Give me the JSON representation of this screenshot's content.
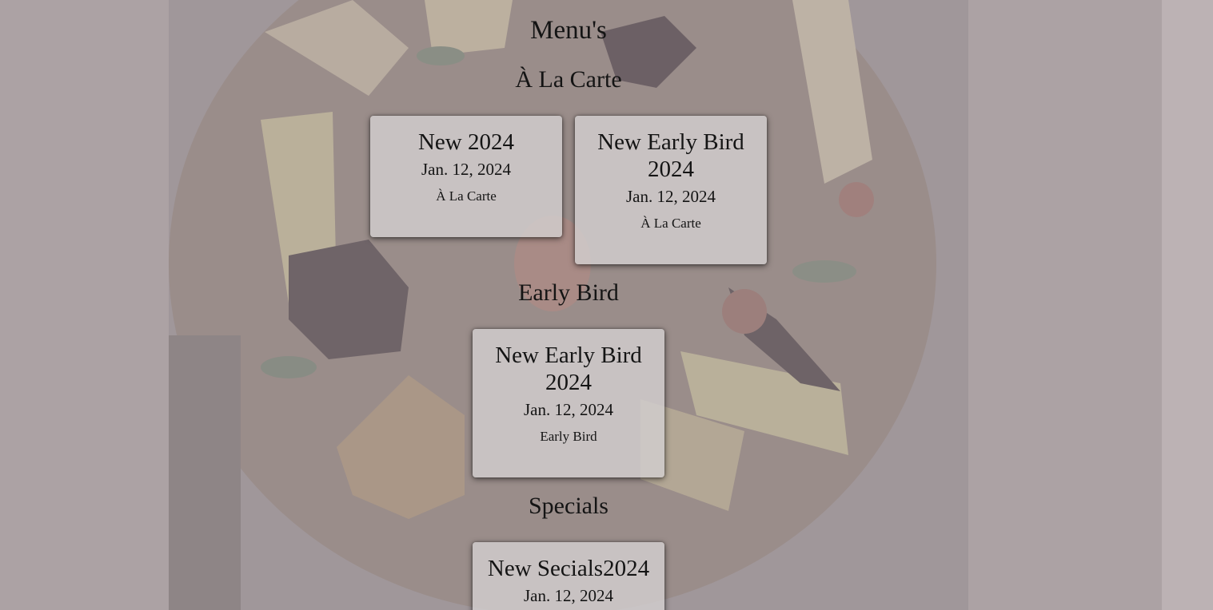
{
  "page": {
    "title": "Menu's"
  },
  "colors": {
    "page_background": "#aca2a4",
    "right_strip": "#bcb2b4",
    "card_background": "#d2cece",
    "text": "#141414"
  },
  "sections": [
    {
      "title": "À La Carte",
      "cards": [
        {
          "title": "New 2024",
          "date": "Jan. 12, 2024",
          "category": "À La Carte"
        },
        {
          "title": "New Early Bird 2024",
          "date": "Jan. 12, 2024",
          "category": "À La Carte"
        }
      ]
    },
    {
      "title": "Early Bird",
      "cards": [
        {
          "title": "New Early Bird 2024",
          "date": "Jan. 12, 2024",
          "category": "Early Bird"
        }
      ]
    },
    {
      "title": "Specials",
      "cards": [
        {
          "title": "New Secials2024",
          "date": "Jan. 12, 2024",
          "category": ""
        }
      ]
    }
  ]
}
